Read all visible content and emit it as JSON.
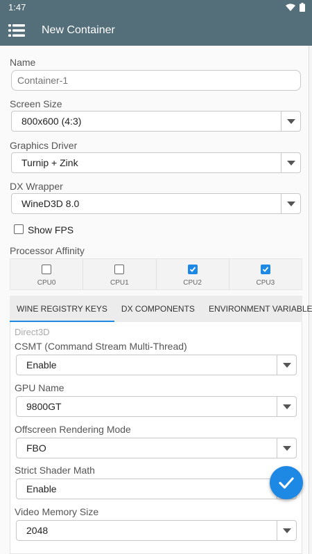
{
  "status": {
    "time": "1:47"
  },
  "app_bar": {
    "title": "New Container"
  },
  "form": {
    "name": {
      "label": "Name",
      "placeholder": "Container-1"
    },
    "screen_size": {
      "label": "Screen Size",
      "value": "800x600 (4:3)"
    },
    "graphics_driver": {
      "label": "Graphics Driver",
      "value": "Turnip + Zink"
    },
    "dx_wrapper": {
      "label": "DX Wrapper",
      "value": "WineD3D 8.0"
    },
    "show_fps": {
      "label": "Show FPS",
      "checked": false
    },
    "processor_affinity": {
      "label": "Processor Affinity",
      "cpus": [
        {
          "label": "CPU0",
          "checked": false
        },
        {
          "label": "CPU1",
          "checked": false
        },
        {
          "label": "CPU2",
          "checked": true
        },
        {
          "label": "CPU3",
          "checked": true
        }
      ]
    }
  },
  "tabs": [
    {
      "label": "WINE REGISTRY KEYS",
      "active": true
    },
    {
      "label": "DX COMPONENTS",
      "active": false
    },
    {
      "label": "ENVIRONMENT VARIABLES",
      "active": false
    }
  ],
  "registry": {
    "section": "Direct3D",
    "csmt": {
      "label": "CSMT (Command Stream Multi-Thread)",
      "value": "Enable"
    },
    "gpu_name": {
      "label": "GPU Name",
      "value": "9800GT"
    },
    "offscreen_rendering": {
      "label": "Offscreen Rendering Mode",
      "value": "FBO"
    },
    "strict_shader_math": {
      "label": "Strict Shader Math",
      "value": "Enable"
    },
    "video_memory": {
      "label": "Video Memory Size",
      "value": "2048"
    }
  },
  "colors": {
    "app_bar": "#546e7a",
    "accent": "#1e88e5"
  },
  "icons": [
    "menu-icon",
    "wifi-icon",
    "battery-icon",
    "checkmark-icon",
    "chevron-down-icon"
  ]
}
